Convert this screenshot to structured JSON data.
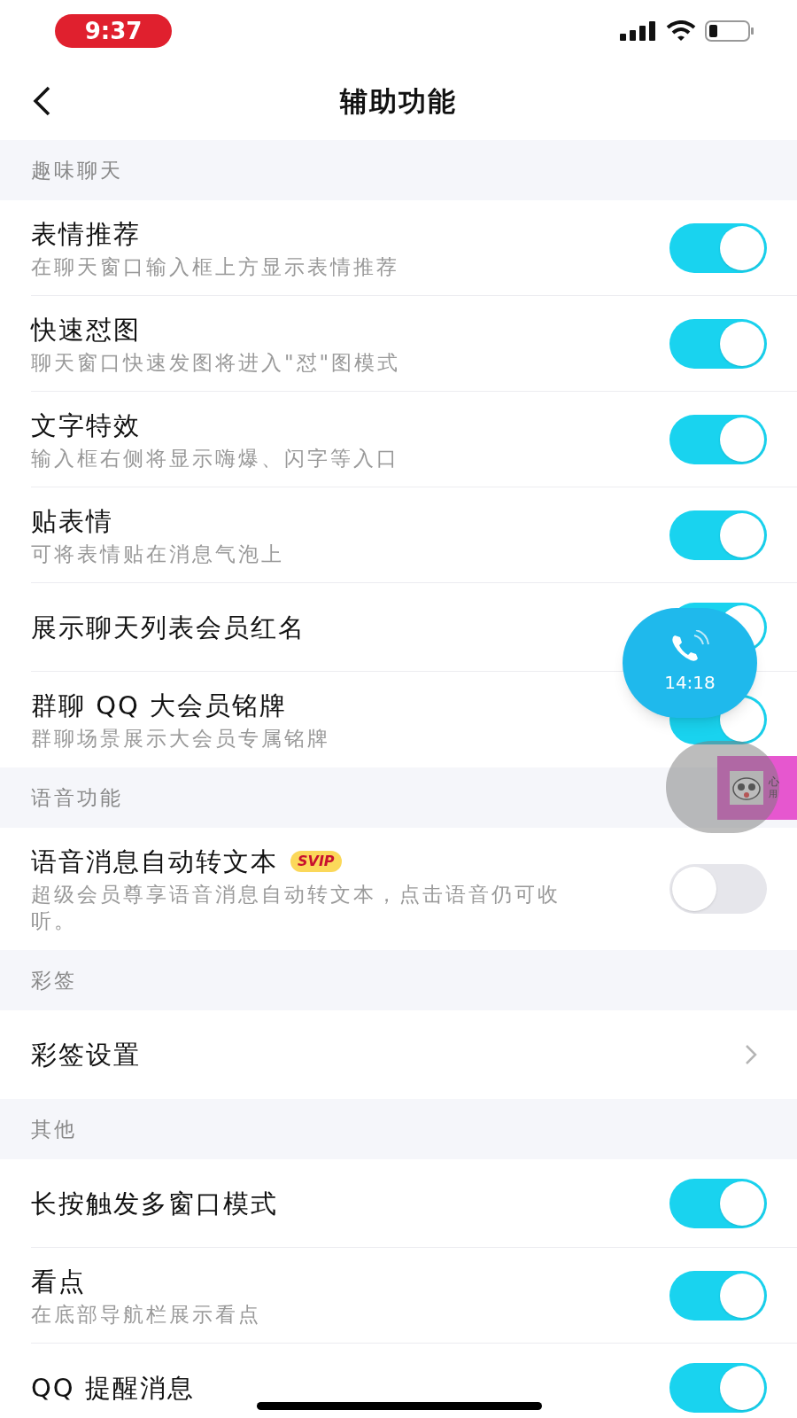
{
  "status_bar": {
    "time": "9:37"
  },
  "nav": {
    "title": "辅助功能"
  },
  "sections": [
    {
      "header": "趣味聊天",
      "items": [
        {
          "kind": "toggle",
          "title": "表情推荐",
          "subtitle": "在聊天窗口输入框上方显示表情推荐",
          "on": true
        },
        {
          "kind": "toggle",
          "title": "快速怼图",
          "subtitle": "聊天窗口快速发图将进入\"怼\"图模式",
          "on": true
        },
        {
          "kind": "toggle",
          "title": "文字特效",
          "subtitle": "输入框右侧将显示嗨爆、闪字等入口",
          "on": true
        },
        {
          "kind": "toggle",
          "title": "贴表情",
          "subtitle": "可将表情贴在消息气泡上",
          "on": true
        },
        {
          "kind": "toggle",
          "title": "展示聊天列表会员红名",
          "on": true
        },
        {
          "kind": "toggle",
          "title": "群聊 QQ 大会员铭牌",
          "subtitle": "群聊场景展示大会员专属铭牌",
          "on": true
        }
      ]
    },
    {
      "header": "语音功能",
      "items": [
        {
          "kind": "toggle",
          "title": "语音消息自动转文本",
          "badge": "SVIP",
          "subtitle": "超级会员尊享语音消息自动转文本，点击语音仍可收听。",
          "on": false
        }
      ]
    },
    {
      "header": "彩签",
      "items": [
        {
          "kind": "link",
          "title": "彩签设置"
        }
      ]
    },
    {
      "header": "其他",
      "items": [
        {
          "kind": "toggle",
          "title": "长按触发多窗口模式",
          "on": true
        },
        {
          "kind": "toggle",
          "title": "看点",
          "subtitle": "在底部导航栏展示看点",
          "on": true
        },
        {
          "kind": "toggle",
          "title": "QQ 提醒消息",
          "on": true
        }
      ]
    }
  ],
  "call_bubble": {
    "duration": "14:18"
  },
  "notification": {
    "line_1": "心",
    "line_2": "用"
  }
}
